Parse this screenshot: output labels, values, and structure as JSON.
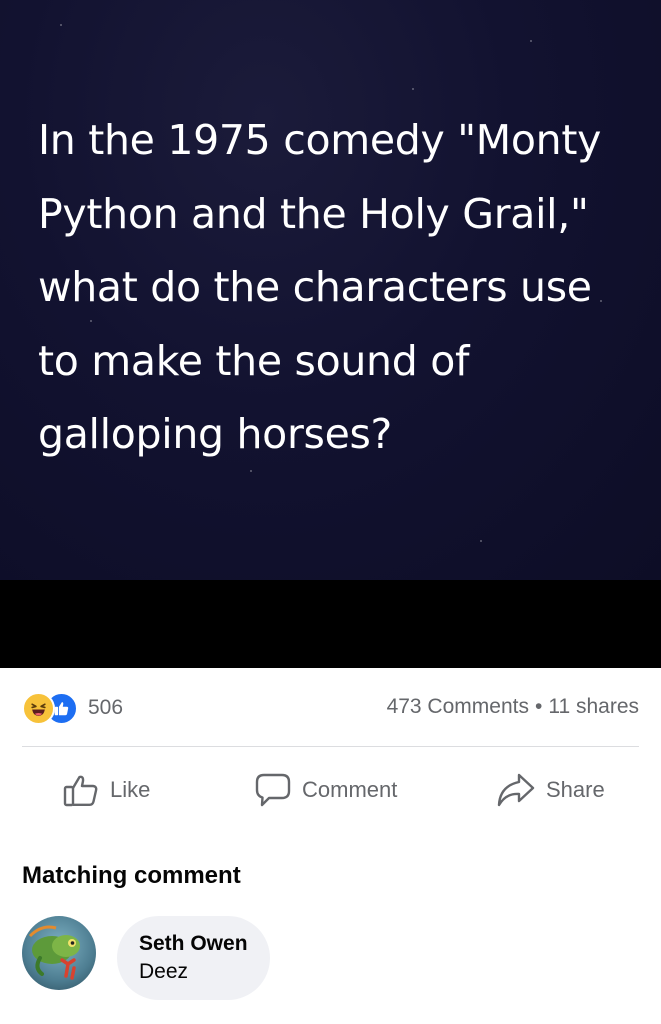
{
  "post": {
    "question": "In the 1975 comedy \"Monty Python and the Holy Grail,\" what do the characters use to make the sound of galloping horses?"
  },
  "stats": {
    "reaction_icons": [
      "haha-reaction-icon",
      "like-reaction-icon"
    ],
    "reaction_count": "506",
    "comments": "473 Comments",
    "separator": "•",
    "shares": "11 shares"
  },
  "actions": {
    "like_label": "Like",
    "comment_label": "Comment",
    "share_label": "Share"
  },
  "matching_comment": {
    "title": "Matching comment",
    "author": "Seth Owen",
    "text": "Deez"
  },
  "colors": {
    "card_background": "#121230",
    "like_blue": "#1d6ef2",
    "haha_yellow": "#f7c23a",
    "secondary_text": "#65676b",
    "bubble": "#f0f1f5"
  }
}
